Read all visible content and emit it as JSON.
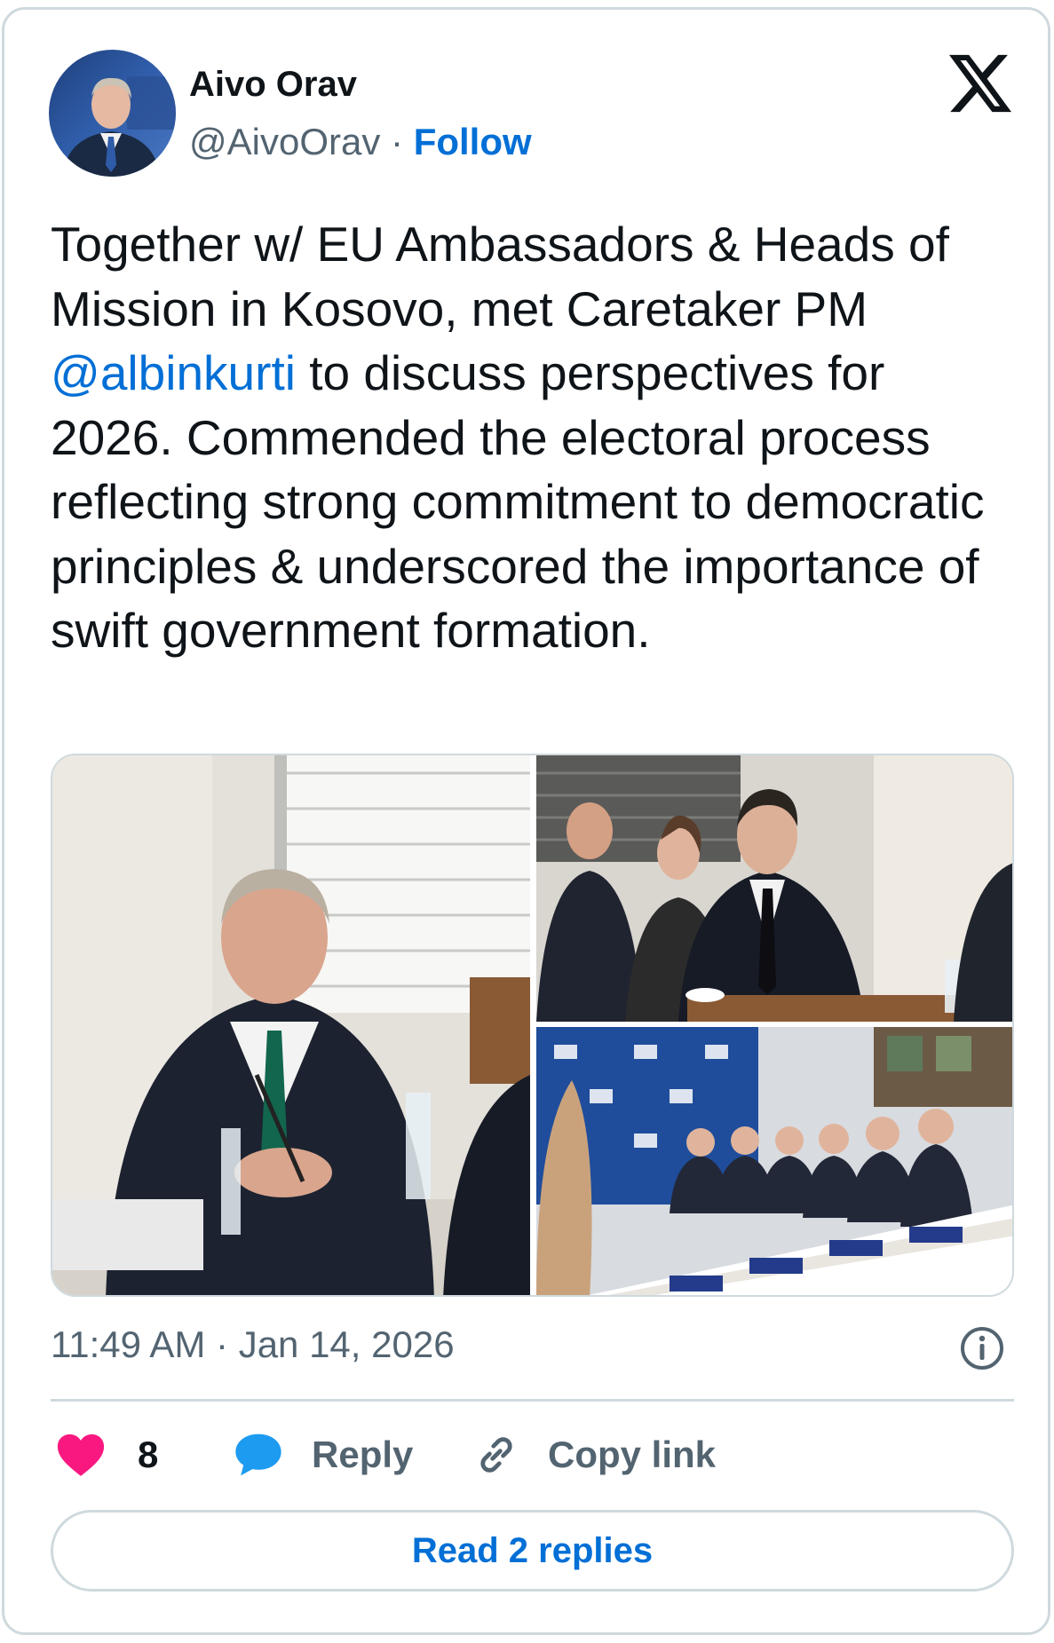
{
  "author": {
    "name": "Aivo Orav",
    "handle": "@AivoOrav",
    "separator": "·",
    "follow_label": "Follow"
  },
  "tweet": {
    "text_before": "Together w/ EU Ambassadors & Heads of Mission in Kosovo, met Caretaker PM",
    "mention": "@albinkurti",
    "text_after": "to discuss perspectives for 2026. Commended the electoral process reflecting strong commitment to democratic principles & underscored the importance of swift government formation."
  },
  "timestamp": {
    "time": "11:49 AM",
    "separator": "·",
    "date": "Jan 14, 2026"
  },
  "actions": {
    "like_count": "8",
    "reply_label": "Reply",
    "copy_label": "Copy link"
  },
  "read_replies_label": "Read 2 replies",
  "colors": {
    "accent": "#006fd6",
    "like": "#f91880",
    "reply_bubble": "#1d9bf0",
    "muted_text": "#536471",
    "border": "#cfd9de"
  },
  "icons": [
    "x-logo-icon",
    "info-icon",
    "heart-icon",
    "reply-bubble-icon",
    "link-icon"
  ]
}
